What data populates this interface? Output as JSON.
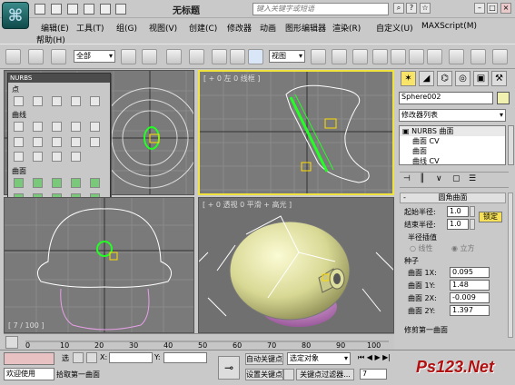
{
  "app": {
    "title": "无标题",
    "search_placeholder": "键入关键字或短语"
  },
  "menu": [
    "编辑(E)",
    "工具(T)",
    "组(G)",
    "视图(V)",
    "创建(C)",
    "修改器",
    "动画",
    "图形编辑器",
    "渲染(R)",
    "自定义(U)",
    "MAXScript(M)",
    "帮助(H)"
  ],
  "toolbar": {
    "filter": "全部",
    "ref_coord": "视图"
  },
  "viewports": {
    "top_right_label": "[ + 0 左 0 线框 ]",
    "bottom_left_label": "[ 7 / 100 ]",
    "bottom_right_label": "[ + 0 透视 0 平滑 + 高光 ]"
  },
  "nurbs": {
    "title": "NURBS",
    "sections": [
      "点",
      "曲线",
      "曲面"
    ]
  },
  "cmd": {
    "object_name": "Sphere002",
    "modifier_list": "修改器列表",
    "stack": [
      "NURBS 曲面",
      "曲面 CV",
      "曲面",
      "曲线 CV",
      "曲线"
    ],
    "rollout_title": "圆角曲面",
    "start_radius_label": "起始半径:",
    "start_radius": "1.0",
    "end_radius_label": "结束半径:",
    "end_radius": "1.0",
    "lock_label": "锁定",
    "radius_interp": "半径插值",
    "linear": "线性",
    "cubic": "立方",
    "seed": "种子",
    "surf1x_label": "曲面 1X:",
    "surf1x": "0.095",
    "surf1y_label": "曲面 1Y:",
    "surf1y": "1.48",
    "surf2x_label": "曲面 2X:",
    "surf2x": "-0.009",
    "surf2y_label": "曲面 2Y:",
    "surf2y": "1.397",
    "trim_first": "修剪第一曲面"
  },
  "timeline": {
    "ticks": [
      "0",
      "10",
      "20",
      "30",
      "40",
      "50",
      "60",
      "70",
      "80",
      "90",
      "100"
    ],
    "frame": "7 / 100"
  },
  "status": {
    "welcome": "欢迎使用",
    "select_label": "选",
    "prompt": "拾取第一曲面",
    "x_label": "X:",
    "y_label": "Y:",
    "auto_key": "自动关键点",
    "set_key": "设置关键点",
    "selected_obj": "选定对象",
    "key_filters": "关键点过滤器...",
    "frame_value": "7"
  },
  "watermark": "Ps123.Net"
}
